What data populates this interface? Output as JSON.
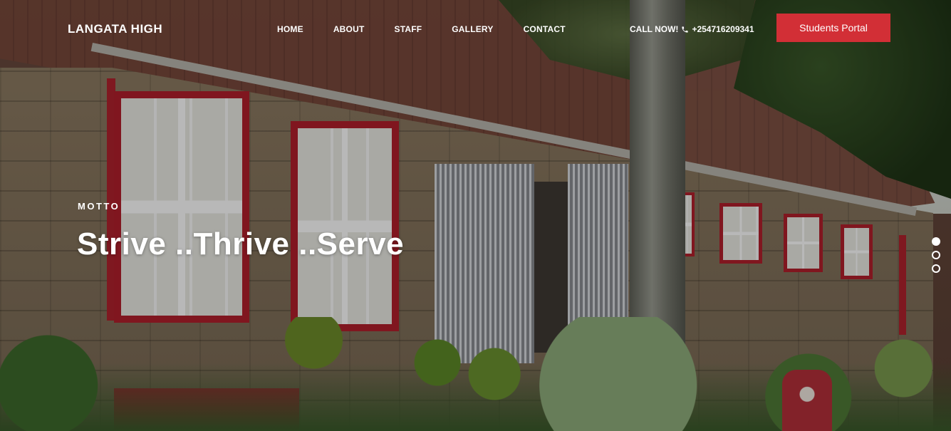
{
  "nav": {
    "brand": "LANGATA HIGH",
    "items": [
      {
        "label": "HOME"
      },
      {
        "label": "ABOUT"
      },
      {
        "label": "STAFF"
      },
      {
        "label": "GALLERY"
      },
      {
        "label": "CONTACT"
      }
    ],
    "call_label": "CALL NOW!",
    "phone": "+254716209341",
    "portal_button": "Students Portal"
  },
  "hero": {
    "eyebrow": "MOTTO",
    "headline": "Strive ..Thrive ..Serve"
  },
  "slider": {
    "total": 3,
    "active_index": 0
  },
  "colors": {
    "accent": "#d22f36",
    "text": "#ffffff"
  }
}
